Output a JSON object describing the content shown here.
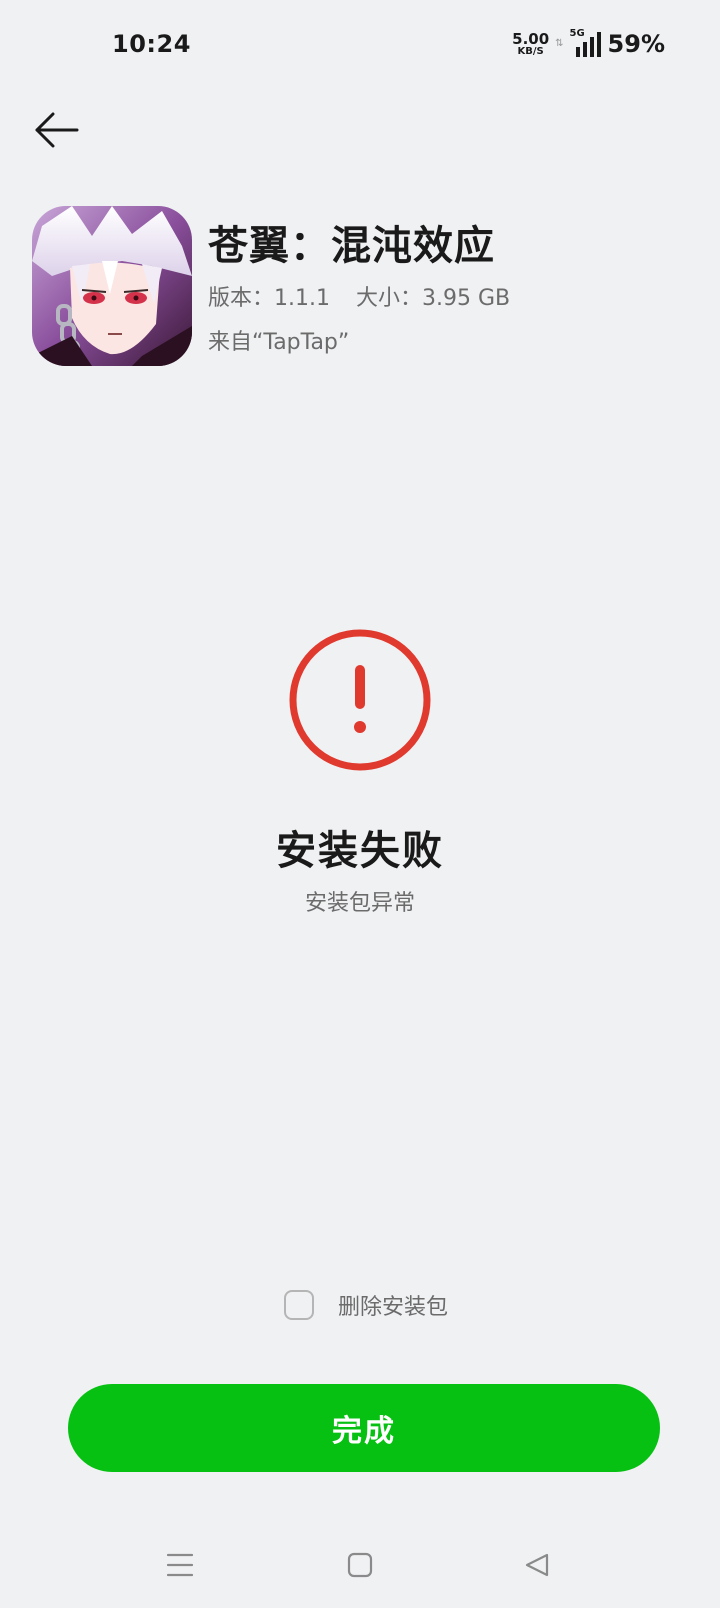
{
  "status_bar": {
    "time": "10:24",
    "net_speed": "5.00",
    "net_speed_unit": "KB/S",
    "network_type": "5G",
    "battery": "59%",
    "icons": [
      "data-arrows-icon",
      "signal-icon"
    ]
  },
  "header": {
    "back_icon": "back-arrow-icon"
  },
  "app": {
    "name": "苍翼：混沌效应",
    "version": "版本：1.1.1",
    "size": "大小：3.95 GB",
    "source": "来自“TapTap”"
  },
  "result": {
    "icon": "error-icon",
    "title": "安装失败",
    "subtitle": "安装包异常"
  },
  "options": {
    "delete_package_label": "删除安装包",
    "delete_package_checked": false
  },
  "actions": {
    "done_label": "完成"
  },
  "nav_bar": {
    "icons": [
      "menu-icon",
      "home-icon",
      "back-icon"
    ]
  },
  "colors": {
    "background": "#f0f1f3",
    "primary_green": "#06c112",
    "error_red": "#e03a2f",
    "secondary_text": "#6b6b6b"
  }
}
